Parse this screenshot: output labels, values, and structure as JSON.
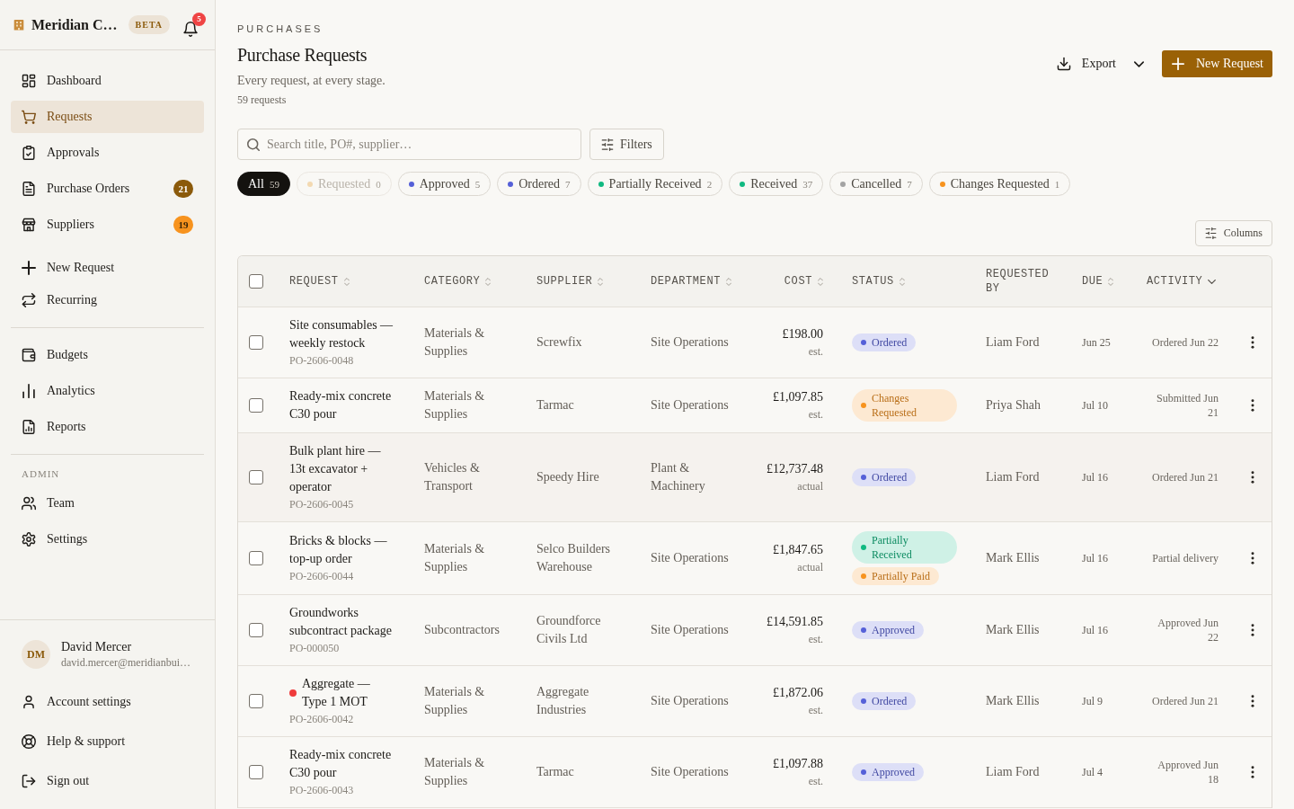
{
  "sidebar": {
    "brand": "Meridian C…",
    "beta_label": "BETA",
    "notification_count": "5",
    "groups": [
      {
        "items": [
          {
            "label": "Dashboard",
            "selected": false
          },
          {
            "label": "Requests",
            "selected": true
          },
          {
            "label": "Approvals",
            "selected": false
          },
          {
            "label": "Purchase Orders",
            "selected": false,
            "badge": {
              "text": "21",
              "color": "#8b5a0b"
            }
          },
          {
            "label": "Suppliers",
            "selected": false,
            "badge": {
              "text": "19",
              "color": "#f7931e"
            }
          }
        ]
      },
      {
        "items": [
          {
            "label": "New Request",
            "selected": false
          },
          {
            "label": "Recurring",
            "selected": false
          }
        ]
      },
      {
        "items": [
          {
            "label": "Budgets",
            "selected": false
          },
          {
            "label": "Analytics",
            "selected": false
          },
          {
            "label": "Reports",
            "selected": false
          }
        ]
      },
      {
        "heading": "ADMIN",
        "items": [
          {
            "label": "Team",
            "selected": false
          },
          {
            "label": "Settings",
            "selected": false
          }
        ]
      }
    ],
    "user": {
      "initials": "DM",
      "name": "David Mercer",
      "email": "david.mercer@meridianbui…"
    },
    "footer_links": [
      {
        "label": "Account settings"
      },
      {
        "label": "Help & support"
      },
      {
        "label": "Sign out"
      }
    ]
  },
  "header": {
    "eyebrow": "PURCHASES",
    "title": "Purchase Requests",
    "subtitle": "Every request, at every stage.",
    "count": "59 requests",
    "actions": [
      {
        "label": "Export",
        "kind": "menu"
      },
      {
        "label": "New Request",
        "kind": "primary"
      }
    ]
  },
  "search": {
    "placeholder": "Search title, PO#, supplier…"
  },
  "filters_button": "Filters",
  "status_filters": [
    {
      "label": "All",
      "count": "59",
      "selected": true,
      "disabled": false
    },
    {
      "label": "Requested",
      "count": "0",
      "color": "#f3d9b1",
      "selected": false,
      "disabled": true
    },
    {
      "label": "Approved",
      "count": "5",
      "color": "#5560d8",
      "selected": false,
      "disabled": false
    },
    {
      "label": "Ordered",
      "count": "7",
      "color": "#5560d8",
      "selected": false,
      "disabled": false
    },
    {
      "label": "Partially Received",
      "count": "2",
      "color": "#10b981",
      "selected": false,
      "disabled": false
    },
    {
      "label": "Received",
      "count": "37",
      "color": "#10b981",
      "selected": false,
      "disabled": false
    },
    {
      "label": "Cancelled",
      "count": "7",
      "color": "#a3a3a3",
      "selected": false,
      "disabled": false
    },
    {
      "label": "Changes Requested",
      "count": "1",
      "color": "#f7931e",
      "selected": false,
      "disabled": false
    }
  ],
  "columns_button": "Columns",
  "table": {
    "all_selected": false,
    "columns": [
      {
        "label": "REQUEST",
        "sortable": true,
        "sorted": false
      },
      {
        "label": "CATEGORY",
        "sortable": true,
        "sorted": false
      },
      {
        "label": "SUPPLIER",
        "sortable": true,
        "sorted": false
      },
      {
        "label": "DEPARTMENT",
        "sortable": true,
        "sorted": false
      },
      {
        "label": "COST",
        "sortable": true,
        "sorted": false
      },
      {
        "label": "STATUS",
        "sortable": true,
        "sorted": false
      },
      {
        "label": "REQUESTED BY"
      },
      {
        "label": "DUE",
        "sortable": true,
        "sorted": false
      },
      {
        "label": "ACTIVITY",
        "sortable": true,
        "sorted": true
      }
    ],
    "rows": [
      {
        "selected": false,
        "highlighted": false,
        "flagged": false,
        "title": "Site consumables — weekly restock",
        "po": "PO-2606-0048",
        "category": "Materials & Supplies",
        "supplier": "Screwfix",
        "department": "Site Operations",
        "cost": "£198.00",
        "basis": "est.",
        "statuses": [
          {
            "label": "Ordered",
            "color": "#5560d8"
          }
        ],
        "requested_by": "Liam Ford",
        "due": "Jun 25",
        "activity": "Ordered Jun 22"
      },
      {
        "selected": false,
        "highlighted": false,
        "flagged": false,
        "title": "Ready-mix concrete C30 pour",
        "category": "Materials & Supplies",
        "supplier": "Tarmac",
        "department": "Site Operations",
        "cost": "£1,097.85",
        "basis": "est.",
        "statuses": [
          {
            "label": "Changes Requested",
            "color": "#f7931e"
          }
        ],
        "requested_by": "Priya Shah",
        "due": "Jul 10",
        "activity": "Submitted Jun 21"
      },
      {
        "selected": false,
        "highlighted": true,
        "flagged": false,
        "title": "Bulk plant hire — 13t excavator + operator",
        "po": "PO-2606-0045",
        "category": "Vehicles & Transport",
        "supplier": "Speedy Hire",
        "department": "Plant & Machinery",
        "cost": "£12,737.48",
        "basis": "actual",
        "statuses": [
          {
            "label": "Ordered",
            "color": "#5560d8"
          }
        ],
        "requested_by": "Liam Ford",
        "due": "Jul 16",
        "activity": "Ordered Jun 21"
      },
      {
        "selected": false,
        "highlighted": false,
        "flagged": false,
        "title": "Bricks & blocks — top-up order",
        "po": "PO-2606-0044",
        "category": "Materials & Supplies",
        "supplier": "Selco Builders Warehouse",
        "department": "Site Operations",
        "cost": "£1,847.65",
        "basis": "actual",
        "statuses": [
          {
            "label": "Partially Received",
            "color": "#10b981"
          },
          {
            "label": "Partially Paid",
            "color": "#f7931e"
          }
        ],
        "requested_by": "Mark Ellis",
        "due": "Jul 16",
        "activity": "Partial delivery"
      },
      {
        "selected": false,
        "highlighted": false,
        "flagged": false,
        "title": "Groundworks subcontract package",
        "po": "PO-000050",
        "category": "Subcontractors",
        "supplier": "Groundforce Civils Ltd",
        "department": "Site Operations",
        "cost": "£14,591.85",
        "basis": "est.",
        "statuses": [
          {
            "label": "Approved",
            "color": "#5560d8"
          }
        ],
        "requested_by": "Mark Ellis",
        "due": "Jul 16",
        "activity": "Approved Jun 22"
      },
      {
        "selected": false,
        "highlighted": false,
        "flagged": true,
        "title": "Aggregate — Type 1 MOT",
        "po": "PO-2606-0042",
        "category": "Materials & Supplies",
        "supplier": "Aggregate Industries",
        "department": "Site Operations",
        "cost": "£1,872.06",
        "basis": "est.",
        "statuses": [
          {
            "label": "Ordered",
            "color": "#5560d8"
          }
        ],
        "requested_by": "Mark Ellis",
        "due": "Jul 9",
        "activity": "Ordered Jun 21"
      },
      {
        "selected": false,
        "highlighted": false,
        "flagged": false,
        "title": "Ready-mix concrete C30 pour",
        "po": "PO-2606-0043",
        "category": "Materials & Supplies",
        "supplier": "Tarmac",
        "department": "Site Operations",
        "cost": "£1,097.88",
        "basis": "est.",
        "statuses": [
          {
            "label": "Approved",
            "color": "#5560d8"
          }
        ],
        "requested_by": "Liam Ford",
        "due": "Jul 4",
        "activity": "Approved Jun 18"
      }
    ]
  }
}
